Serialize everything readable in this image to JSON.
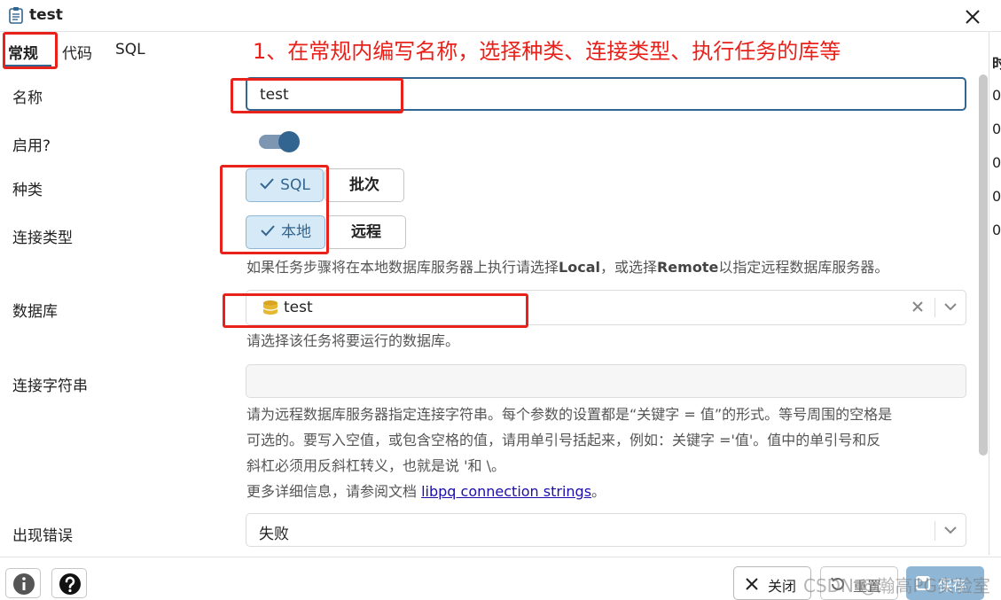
{
  "window": {
    "title": "test"
  },
  "tabs": [
    {
      "label": "常规",
      "active": true
    },
    {
      "label": "代码",
      "active": false
    },
    {
      "label": "SQL",
      "active": false
    }
  ],
  "annotation": "1、在常规内编写名称，选择种类、连接类型、执行任务的库等",
  "right_strip": {
    "header": "时",
    "cells": [
      "0",
      "0",
      "0",
      "0",
      "0"
    ]
  },
  "form": {
    "name": {
      "label": "名称",
      "value": "test"
    },
    "enabled": {
      "label": "启用?",
      "on": true
    },
    "kind": {
      "label": "种类",
      "options": [
        "SQL",
        "批次"
      ],
      "selected": "SQL"
    },
    "connection_type": {
      "label": "连接类型",
      "options": [
        "本地",
        "远程"
      ],
      "selected": "本地",
      "hint_pre": "如果任务步骤将在本地数据库服务器上执行请选择",
      "hint_local": "Local",
      "hint_mid": "，或选择",
      "hint_remote": "Remote",
      "hint_post": "以指定远程数据库服务器。"
    },
    "database": {
      "label": "数据库",
      "value": "test",
      "hint": "请选择该任务将要运行的数据库。"
    },
    "connection_string": {
      "label": "连接字符串",
      "value": "",
      "hint_line1": "请为远程数据库服务器指定连接字符串。每个参数的设置都是“关键字 = 值”的形式。等号周围的空格是",
      "hint_line2": "可选的。要写入空值，或包含空格的值，请用单引号括起来，例如：关键字 ='值'。值中的单引号和反",
      "hint_line3": "斜杠必须用反斜杠转义，也就是说 '和 \\。",
      "hint_line4_pre": "更多详细信息，请参阅文档 ",
      "hint_link": "libpq connection strings",
      "hint_line4_post": "。"
    },
    "on_error": {
      "label": "出现错误",
      "value": "失败"
    }
  },
  "footer": {
    "close_label": "关闭",
    "reset_label": "重置",
    "save_label": "保存"
  },
  "watermark": "CSDN @瀚高PG实验室",
  "colors": {
    "accent": "#326690",
    "annotation_red": "#e8221b",
    "selected_bg": "#d6e9f7"
  }
}
